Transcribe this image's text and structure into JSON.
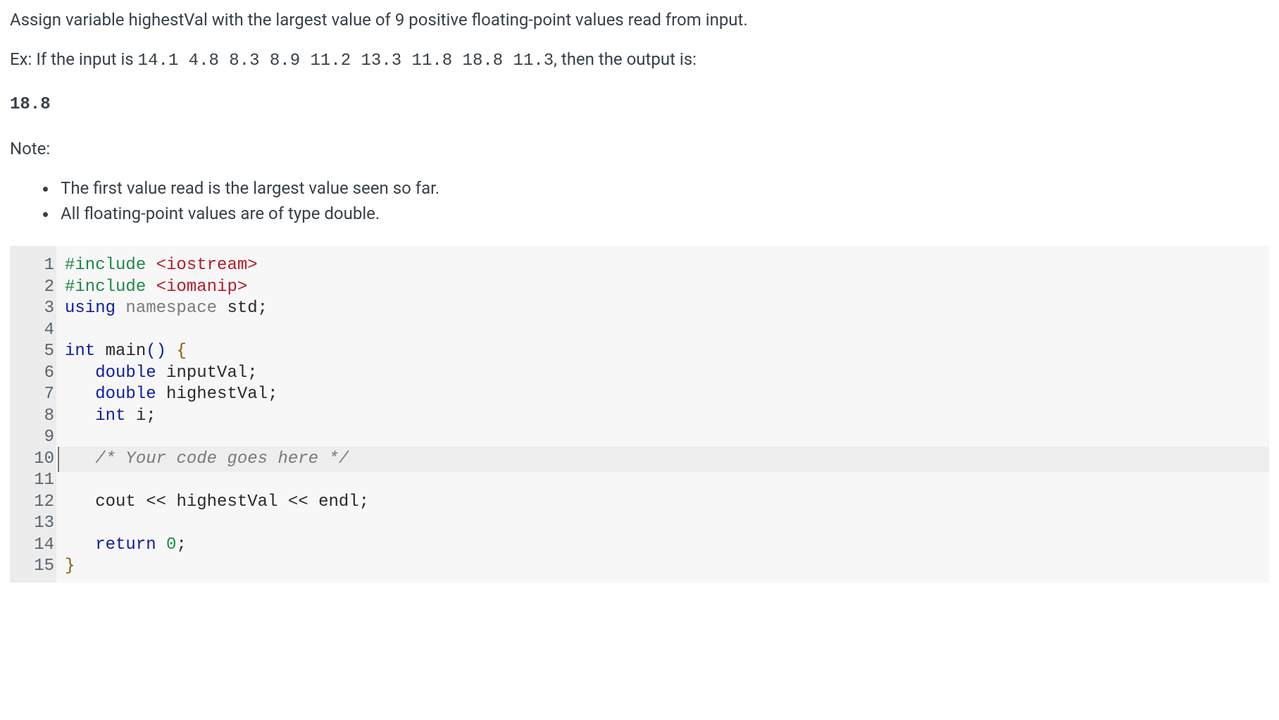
{
  "problem": {
    "prompt_pre": "Assign variable highestVal with the largest value of 9 positive floating-point values read from input.",
    "example_prefix": "Ex: If the input is ",
    "example_input": "14.1 4.8 8.3 8.9 11.2 13.3 11.8 18.8 11.3",
    "example_suffix": ", then the output is:",
    "example_output": "18.8",
    "note_label": "Note:",
    "notes": [
      "The first value read is the largest value seen so far.",
      "All floating-point values are of type double."
    ]
  },
  "code": {
    "highlighted_line": 10,
    "lines": [
      {
        "n": 1,
        "tokens": [
          {
            "t": "#include ",
            "c": "tk-preproc"
          },
          {
            "t": "<iostream>",
            "c": "tk-str"
          }
        ]
      },
      {
        "n": 2,
        "tokens": [
          {
            "t": "#include ",
            "c": "tk-preproc"
          },
          {
            "t": "<iomanip>",
            "c": "tk-str"
          }
        ]
      },
      {
        "n": 3,
        "tokens": [
          {
            "t": "using ",
            "c": "tk-key"
          },
          {
            "t": "namespace ",
            "c": "tk-ns"
          },
          {
            "t": "std",
            "c": "tk-ident"
          },
          {
            "t": ";",
            "c": "tk-sym"
          }
        ]
      },
      {
        "n": 4,
        "tokens": []
      },
      {
        "n": 5,
        "tokens": [
          {
            "t": "int ",
            "c": "tk-type"
          },
          {
            "t": "main",
            "c": "tk-ident"
          },
          {
            "t": "()",
            "c": "tk-paren"
          },
          {
            "t": " ",
            "c": ""
          },
          {
            "t": "{",
            "c": "tk-brace"
          }
        ]
      },
      {
        "n": 6,
        "tokens": [
          {
            "t": "   ",
            "c": ""
          },
          {
            "t": "double ",
            "c": "tk-type"
          },
          {
            "t": "inputVal",
            "c": "tk-var"
          },
          {
            "t": ";",
            "c": "tk-sym"
          }
        ]
      },
      {
        "n": 7,
        "tokens": [
          {
            "t": "   ",
            "c": ""
          },
          {
            "t": "double ",
            "c": "tk-type"
          },
          {
            "t": "highestVal",
            "c": "tk-var"
          },
          {
            "t": ";",
            "c": "tk-sym"
          }
        ]
      },
      {
        "n": 8,
        "tokens": [
          {
            "t": "   ",
            "c": ""
          },
          {
            "t": "int ",
            "c": "tk-type"
          },
          {
            "t": "i",
            "c": "tk-var"
          },
          {
            "t": ";",
            "c": "tk-sym"
          }
        ]
      },
      {
        "n": 9,
        "tokens": []
      },
      {
        "n": 10,
        "tokens": [
          {
            "t": "   ",
            "c": ""
          },
          {
            "t": "/* Your code goes here */",
            "c": "tk-cmt"
          }
        ]
      },
      {
        "n": 11,
        "tokens": []
      },
      {
        "n": 12,
        "tokens": [
          {
            "t": "   ",
            "c": ""
          },
          {
            "t": "cout",
            "c": "tk-ident"
          },
          {
            "t": " << ",
            "c": "tk-sym"
          },
          {
            "t": "highestVal",
            "c": "tk-ident"
          },
          {
            "t": " << ",
            "c": "tk-sym"
          },
          {
            "t": "endl",
            "c": "tk-ident"
          },
          {
            "t": ";",
            "c": "tk-sym"
          }
        ]
      },
      {
        "n": 13,
        "tokens": []
      },
      {
        "n": 14,
        "tokens": [
          {
            "t": "   ",
            "c": ""
          },
          {
            "t": "return ",
            "c": "tk-key"
          },
          {
            "t": "0",
            "c": "tk-num"
          },
          {
            "t": ";",
            "c": "tk-sym"
          }
        ]
      },
      {
        "n": 15,
        "tokens": [
          {
            "t": "}",
            "c": "tk-brace"
          }
        ]
      }
    ]
  }
}
